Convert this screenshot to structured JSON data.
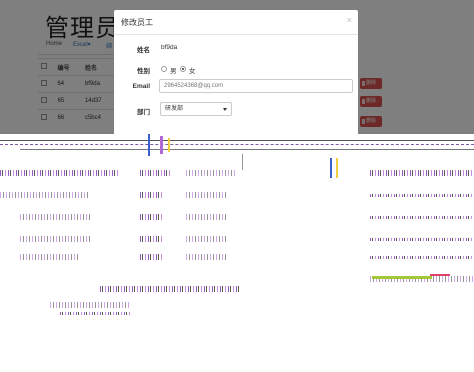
{
  "page": {
    "title": "管理员",
    "tabs": [
      {
        "label": "Home"
      },
      {
        "label": "Excel▾"
      },
      {
        "label": "绑"
      }
    ]
  },
  "table": {
    "headers": [
      "",
      "编号",
      "姓名"
    ],
    "rows": [
      {
        "id": "64",
        "name": "bf9da"
      },
      {
        "id": "65",
        "name": "14d37"
      },
      {
        "id": "66",
        "name": "c5bc4"
      }
    ],
    "delete_label": "删除"
  },
  "modal": {
    "title": "修改员工",
    "close_symbol": "×",
    "name_label": "姓名",
    "name_value": "bf9da",
    "gender_label": "性别",
    "gender_options": [
      "男",
      "女"
    ],
    "gender_selected": "女",
    "email_label": "Email",
    "email_value": "2964524368@qq.com",
    "dept_label": "部门",
    "dept_selected": "研发部"
  },
  "colors": {
    "overlay": "rgba(0,0,0,0.5)",
    "danger": "#d9534f",
    "success": "#5cb85c",
    "link": "#337ab7"
  },
  "icons": [
    "close-icon",
    "trash-icon",
    "caret-down-icon",
    "checkbox-icon"
  ]
}
